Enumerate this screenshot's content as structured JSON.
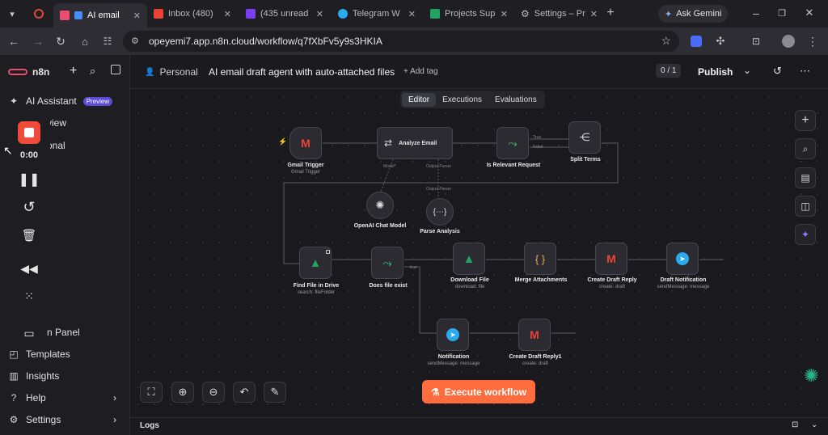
{
  "browser": {
    "tabs": [
      {
        "label": "",
        "icon": "record-icon",
        "color": "#e0463a"
      },
      {
        "label": "AI email",
        "icon": "n8n-icon",
        "color": "#ea4b71"
      },
      {
        "label": "Inbox (480)",
        "icon": "gmail-icon",
        "color": "#ea4335"
      },
      {
        "label": "(435 unread",
        "icon": "yahoo-icon",
        "color": "#7b3ff2"
      },
      {
        "label": "Telegram W",
        "icon": "telegram-icon",
        "color": "#2aabee"
      },
      {
        "label": "Projects Sup",
        "icon": "sheets-icon",
        "color": "#1fa463"
      },
      {
        "label": "Settings – Pr",
        "icon": "gear-icon",
        "color": "#bbbbbb"
      }
    ],
    "new_tab": "+",
    "ask_gemini": "Ask Gemini",
    "url": "opeyemi7.app.n8n.cloud/workflow/q7fXbFv5y9s3HKIA"
  },
  "sidebar": {
    "brand": "n8n",
    "items": [
      {
        "label": "AI Assistant",
        "icon": "sparkle-icon"
      },
      {
        "label": "view",
        "icon": "overview-icon"
      },
      {
        "label": "onal",
        "icon": "personal-icon"
      },
      {
        "label": "n Panel",
        "icon": "admin-panel-icon"
      },
      {
        "label": "Templates",
        "icon": "templates-icon"
      },
      {
        "label": "Insights",
        "icon": "insights-icon"
      },
      {
        "label": "Help",
        "icon": "help-icon"
      },
      {
        "label": "Settings",
        "icon": "settings-icon"
      }
    ],
    "preview_badge": "Preview"
  },
  "recorder": {
    "time": "0:00"
  },
  "header": {
    "project": "Personal",
    "workflow_name": "AI email draft agent with auto-attached files",
    "add_tag": "+ Add tag",
    "counter": "0 / 1",
    "publish": "Publish",
    "tabs": [
      "Editor",
      "Executions",
      "Evaluations"
    ]
  },
  "nodes": [
    {
      "name": "Gmail Trigger",
      "sub": "Gmail Trigger"
    },
    {
      "name": "Analyze Email",
      "sub": ""
    },
    {
      "name": "Is Relevant Request",
      "sub": ""
    },
    {
      "name": "Split Terms",
      "sub": ""
    },
    {
      "name": "OpenAI Chat Model",
      "sub": ""
    },
    {
      "name": "Parse Analysis",
      "sub": ""
    },
    {
      "name": "Find File in Drive",
      "sub": "search: fileFolder"
    },
    {
      "name": "Does file exist",
      "sub": ""
    },
    {
      "name": "Download File",
      "sub": "download: file"
    },
    {
      "name": "Merge Attachments",
      "sub": ""
    },
    {
      "name": "Create Draft Reply",
      "sub": "create: draft"
    },
    {
      "name": "Draft Notification",
      "sub": "sendMessage: message"
    },
    {
      "name": "Notification",
      "sub": "sendMessage: message"
    },
    {
      "name": "Create Draft Reply1",
      "sub": "create: draft"
    }
  ],
  "edge_labels": {
    "model": "Model*",
    "output_parser": "Output Parser",
    "true": "True",
    "false": "False",
    "true2": "true"
  },
  "execute_button": "Execute workflow",
  "logs": "Logs",
  "colors": {
    "accent": "#ff6d3f",
    "gmail_red": "#ea4335",
    "drive_green": "#1fa463",
    "telegram_blue": "#2aabee",
    "merge_orange": "#f0a54a",
    "node_green": "#3ecf7a"
  }
}
